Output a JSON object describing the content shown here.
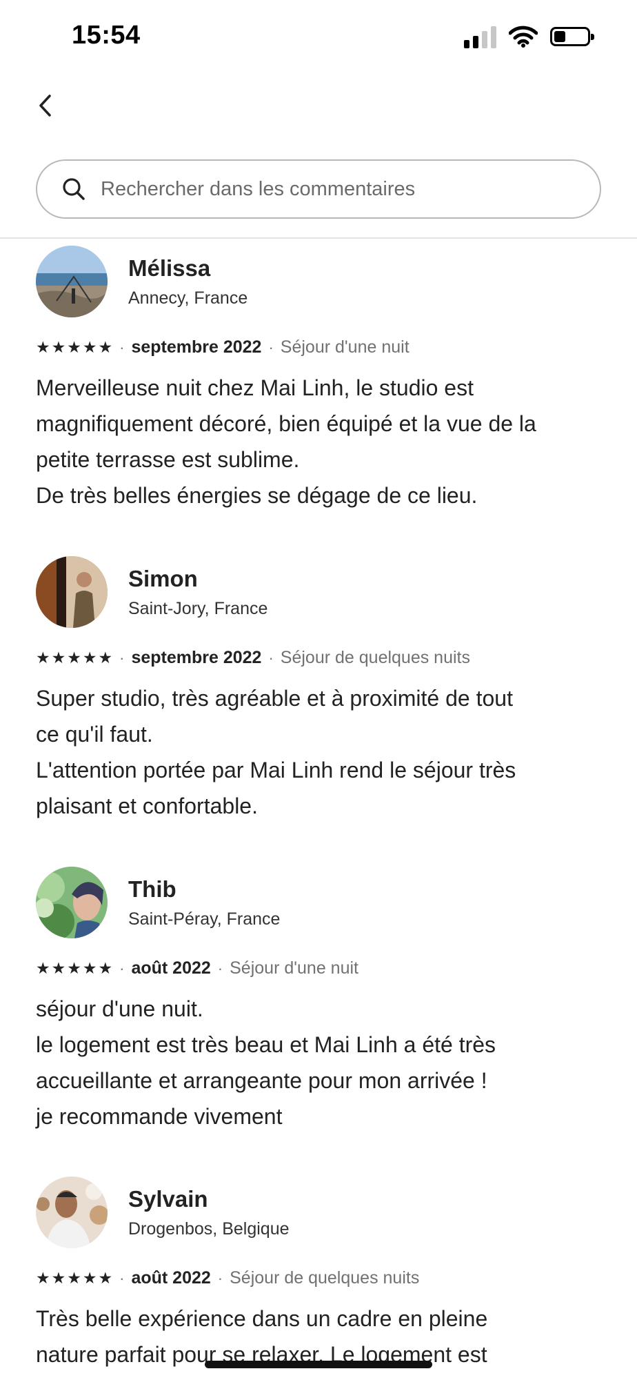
{
  "status_bar": {
    "time": "15:54",
    "battery_level": 0.35
  },
  "search": {
    "placeholder": "Rechercher dans les commentaires",
    "value": ""
  },
  "icons": {
    "back": "chevron-left-icon",
    "search": "search-icon",
    "star": "star-icon"
  },
  "colors": {
    "text": "#222222",
    "muted": "#717171",
    "border": "#b8b8b8"
  },
  "reviews": [
    {
      "name": "Mélissa",
      "location": "Annecy, France",
      "rating": 5,
      "date": "septembre 2022",
      "stay": "Séjour d'une nuit",
      "lines": [
        "Merveilleuse nuit chez Mai Linh, le studio est",
        "magnifiquement décoré, bien équipé et la vue de la",
        "petite terrasse est sublime.",
        "De très belles énergies se dégage de ce lieu."
      ]
    },
    {
      "name": "Simon",
      "location": "Saint-Jory, France",
      "rating": 5,
      "date": "septembre 2022",
      "stay": "Séjour de quelques nuits",
      "lines": [
        "Super studio, très agréable et à proximité de tout",
        "ce qu'il faut.",
        "L'attention portée par Mai Linh rend le séjour très",
        "plaisant et confortable."
      ]
    },
    {
      "name": "Thib",
      "location": "Saint-Péray, France",
      "rating": 5,
      "date": "août 2022",
      "stay": "Séjour d'une nuit",
      "lines": [
        "séjour d'une nuit.",
        "le logement est très beau et Mai Linh a été très",
        "accueillante et arrangeante pour mon arrivée !",
        "je recommande vivement"
      ]
    },
    {
      "name": "Sylvain",
      "location": "Drogenbos, Belgique",
      "rating": 5,
      "date": "août 2022",
      "stay": "Séjour de quelques nuits",
      "lines": [
        "Très belle expérience dans un cadre en pleine",
        "nature parfait pour se relaxer. Le logement est"
      ]
    }
  ]
}
